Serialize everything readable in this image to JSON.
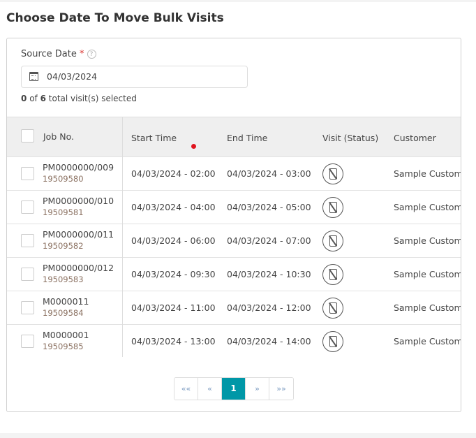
{
  "title": "Choose Date To Move Bulk Visits",
  "source_date": {
    "label": "Source Date",
    "required_mark": "*",
    "help_icon": "question-circle-icon",
    "value": "04/03/2024",
    "icon": "calendar-icon"
  },
  "selection": {
    "selected": "0",
    "of": "of",
    "total": "6",
    "suffix": "total visit(s) selected"
  },
  "columns": [
    "Job No.",
    "Start Time",
    "End Time",
    "Visit (Status)",
    "Customer"
  ],
  "rows": [
    {
      "job": "PM0000000/009",
      "id": "19509580",
      "start": "04/03/2024 - 02:00",
      "end": "04/03/2024 - 03:00",
      "status_icon": "mobile-off-icon",
      "customer": "Sample Customer"
    },
    {
      "job": "PM0000000/010",
      "id": "19509581",
      "start": "04/03/2024 - 04:00",
      "end": "04/03/2024 - 05:00",
      "status_icon": "mobile-off-icon",
      "customer": "Sample Customer"
    },
    {
      "job": "PM0000000/011",
      "id": "19509582",
      "start": "04/03/2024 - 06:00",
      "end": "04/03/2024 - 07:00",
      "status_icon": "mobile-off-icon",
      "customer": "Sample Customer"
    },
    {
      "job": "PM0000000/012",
      "id": "19509583",
      "start": "04/03/2024 - 09:30",
      "end": "04/03/2024 - 10:30",
      "status_icon": "mobile-off-icon",
      "customer": "Sample Customer"
    },
    {
      "job": "M0000011",
      "id": "19509584",
      "start": "04/03/2024 - 11:00",
      "end": "04/03/2024 - 12:00",
      "status_icon": "mobile-off-icon",
      "customer": "Sample Customer"
    },
    {
      "job": "M0000001",
      "id": "19509585",
      "start": "04/03/2024 - 13:00",
      "end": "04/03/2024 - 14:00",
      "status_icon": "mobile-off-icon",
      "customer": "Sample Customer"
    }
  ],
  "pagination": {
    "first": "««",
    "prev": "«",
    "current": "1",
    "next": "»",
    "last": "»»"
  },
  "colors": {
    "accent": "#0097a7",
    "required": "#d9302c"
  }
}
